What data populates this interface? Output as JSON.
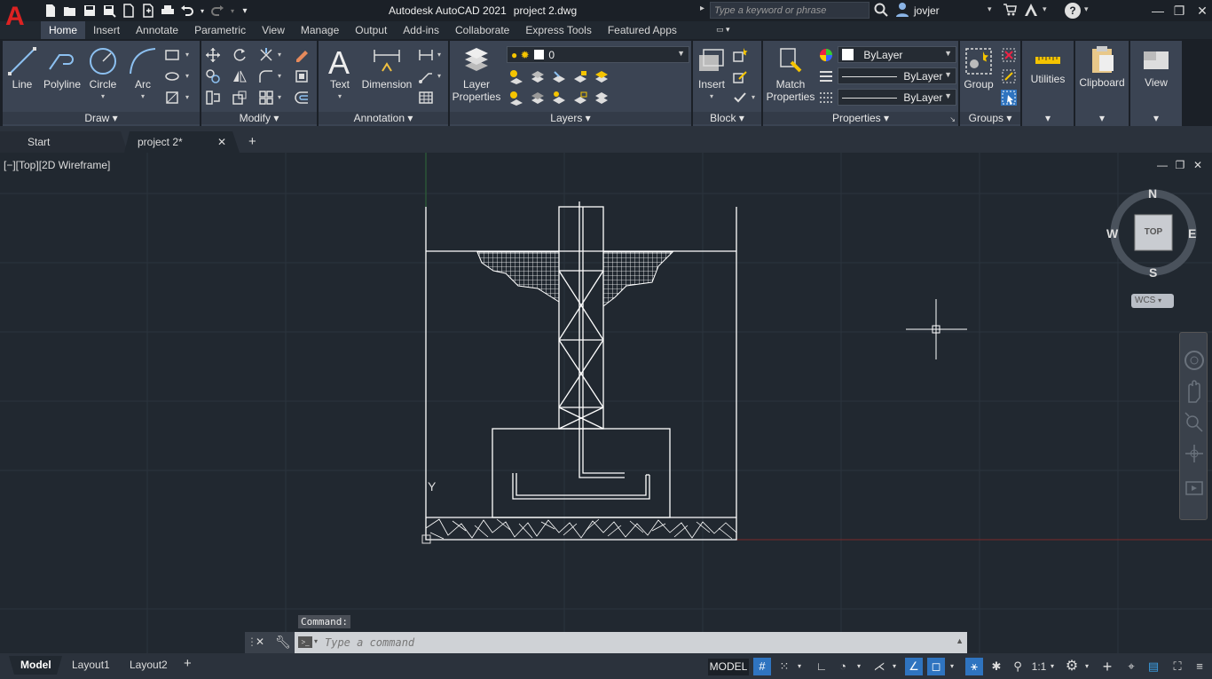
{
  "app": {
    "logo": "A",
    "title": "Autodesk AutoCAD 2021",
    "document": "project 2.dwg",
    "search_placeholder": "Type a keyword or phrase",
    "user": "jovjer"
  },
  "ribbon_tabs": [
    "Home",
    "Insert",
    "Annotate",
    "Parametric",
    "View",
    "Manage",
    "Output",
    "Add-ins",
    "Collaborate",
    "Express Tools",
    "Featured Apps"
  ],
  "ribbon": {
    "draw": {
      "title": "Draw",
      "line": "Line",
      "polyline": "Polyline",
      "circle": "Circle",
      "arc": "Arc"
    },
    "modify": {
      "title": "Modify"
    },
    "annotation": {
      "title": "Annotation",
      "text": "Text",
      "dimension": "Dimension"
    },
    "layers": {
      "title": "Layers",
      "layer_properties_1": "Layer",
      "layer_properties_2": "Properties",
      "current_layer": "0"
    },
    "block": {
      "title": "Block",
      "insert": "Insert"
    },
    "properties": {
      "title": "Properties",
      "match_1": "Match",
      "match_2": "Properties",
      "color": "ByLayer",
      "linetype": "ByLayer",
      "lineweight": "ByLayer"
    },
    "groups": {
      "title": "Groups",
      "group": "Group"
    },
    "utilities": "Utilities",
    "clipboard": "Clipboard",
    "view": "View"
  },
  "doc_tabs": {
    "start": "Start",
    "current": "project 2*",
    "new": "+"
  },
  "viewport": {
    "label": "[−][Top][2D Wireframe]",
    "compass": {
      "n": "N",
      "s": "S",
      "e": "E",
      "w": "W",
      "face": "TOP"
    },
    "wcs": "WCS",
    "ucs_y": "Y"
  },
  "command": {
    "label": "Command:",
    "placeholder": "Type  a  command"
  },
  "layouts": {
    "model": "Model",
    "layout1": "Layout1",
    "layout2": "Layout2",
    "add": "+"
  },
  "status": {
    "model": "MODEL",
    "scale": "1:1"
  },
  "colors": {
    "accent": "#2f74c0",
    "panel": "#3b4453",
    "background": "#212830"
  }
}
